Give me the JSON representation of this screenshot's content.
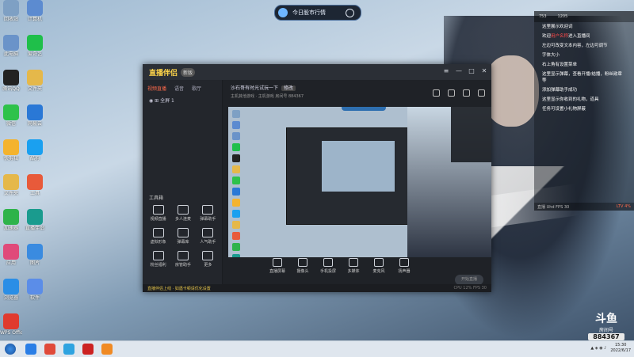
{
  "top_search": {
    "text": "今日股市行情"
  },
  "desktop_icons": [
    {
      "label": "回收站",
      "color": "#7ea0c4"
    },
    {
      "label": "计算机",
      "color": "#5c8bd0"
    },
    {
      "label": "此电脑",
      "color": "#6a93c9"
    },
    {
      "label": "爱奇艺",
      "color": "#1fbf4a"
    },
    {
      "label": "腾讯QQ",
      "color": "#222222"
    },
    {
      "label": "文件夹",
      "color": "#e5b84a"
    },
    {
      "label": "微信",
      "color": "#2ec24b"
    },
    {
      "label": "网易云",
      "color": "#2a78d6"
    },
    {
      "label": "快剪辑",
      "color": "#f4b32e"
    },
    {
      "label": "酷狗",
      "color": "#1aa0f0"
    },
    {
      "label": "文件夹",
      "color": "#e5b84a"
    },
    {
      "label": "工具",
      "color": "#e85a3a"
    },
    {
      "label": "加速器",
      "color": "#2eb34a"
    },
    {
      "label": "直播伴侣",
      "color": "#1a9b8e"
    },
    {
      "label": "应用",
      "color": "#e04a7a"
    },
    {
      "label": "图片",
      "color": "#3a8be0"
    },
    {
      "label": "浏览器",
      "color": "#2a8ee6"
    },
    {
      "label": "软件",
      "color": "#5b8de8"
    },
    {
      "label": "WPS Office",
      "color": "#e03a2e"
    }
  ],
  "app": {
    "brand": "直播伴侣",
    "badge": "新版",
    "left_tabs": [
      "视频直播",
      "语音",
      "歌厅"
    ],
    "scene_label": "全屏 1",
    "tools_title": "工具箱",
    "tools": [
      "视频直播",
      "多人连麦",
      "弹幕助手",
      "虚拟形象",
      "弹幕库",
      "人气助手",
      "粉丝福利",
      "房管助手",
      "更多"
    ],
    "room_title": "沙石哥有时光试玩一下",
    "room_edit": "修改",
    "room_info": "主机其他游戏 · 主机游戏   房间号 884367",
    "bottom_tools": [
      "直播屏幕",
      "摄像头",
      "手机投屏",
      "多媒体",
      "麦克风",
      "扬声器"
    ],
    "start_live": "开始直播",
    "notice": "直播伴侣上线 · 如遇卡顿请优化设置",
    "stats": "CPU 12% FPS 30"
  },
  "chat": {
    "head": [
      "753",
      "1205"
    ],
    "lines": [
      {
        "text": "这里展示欢迎词"
      },
      {
        "text": "欢迎",
        "highlight": "用户名称",
        "rest": "进入直播间"
      },
      {
        "text": "左边可改变文本内容，左边可调节"
      },
      {
        "text": "字体大小"
      },
      {
        "text": "右上角有设置菜单"
      },
      {
        "text": "这里显示弹幕，查看开播/结播，粉丝勋章等"
      },
      {
        "text": "添加弹幕助手成功"
      },
      {
        "text": "这里显示你收到的礼物，道具"
      },
      {
        "text": "任务可设置小礼物屏蔽"
      }
    ],
    "foot_left": "直播 Uhd FPS 30",
    "foot_right": "LTV 4%"
  },
  "watermark": {
    "logo": "斗鱼",
    "sub": "房间号",
    "room": "884367"
  },
  "taskbar": {
    "time": "15:30",
    "date": "2022/6/17",
    "items": [
      "#2a7ee6",
      "#e04a3a",
      "#2ea3e0",
      "#cc2222",
      "#f08a24"
    ]
  }
}
